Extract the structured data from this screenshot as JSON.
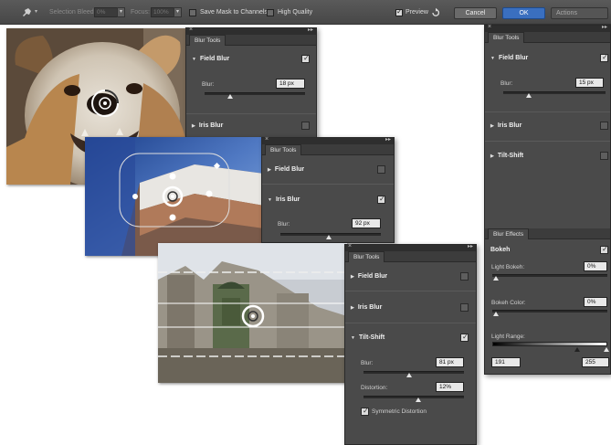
{
  "options_bar": {
    "selection_bleed_label": "Selection Bleed:",
    "selection_bleed_value": "0%",
    "focus_label": "Focus:",
    "focus_value": "100%",
    "save_mask_label": "Save Mask to Channels",
    "save_mask_checked": false,
    "high_quality_label": "High Quality",
    "high_quality_checked": false,
    "preview_label": "Preview",
    "preview_checked": true,
    "cancel_label": "Cancel",
    "ok_label": "OK",
    "actions_label": "Actions"
  },
  "panel_dog": {
    "tab": "Blur Tools",
    "field_blur": {
      "label": "Field Blur",
      "checked": true,
      "blur_label": "Blur:",
      "blur_value": "18 px",
      "slider": 0.4
    },
    "iris_blur": {
      "label": "Iris Blur",
      "checked": false
    }
  },
  "panel_iris": {
    "tab": "Blur Tools",
    "field_blur": {
      "label": "Field Blur",
      "checked": false
    },
    "iris_blur": {
      "label": "Iris Blur",
      "checked": true,
      "blur_label": "Blur:",
      "blur_value": "92 px",
      "slider": 0.48
    }
  },
  "panel_tilt": {
    "tab": "Blur Tools",
    "field_blur": {
      "label": "Field Blur",
      "checked": false
    },
    "iris_blur": {
      "label": "Iris Blur",
      "checked": false
    },
    "tilt_shift": {
      "label": "Tilt-Shift",
      "checked": true,
      "blur_label": "Blur:",
      "blur_value": "81 px",
      "blur_slider": 0.45,
      "distortion_label": "Distortion:",
      "distortion_value": "12%",
      "distortion_slider": 0.55,
      "symmetric_label": "Symmetric Distortion",
      "symmetric_checked": true
    }
  },
  "panel_right": {
    "tab": "Blur Tools",
    "field_blur": {
      "label": "Field Blur",
      "checked": true,
      "blur_label": "Blur:",
      "blur_value": "15 px",
      "slider": 0.35
    },
    "iris_blur": {
      "label": "Iris Blur",
      "checked": false
    },
    "tilt_shift": {
      "label": "Tilt-Shift",
      "checked": false
    },
    "effects_tab": "Blur Effects",
    "bokeh": {
      "label": "Bokeh",
      "checked": true,
      "light_bokeh_label": "Light Bokeh:",
      "light_bokeh_value": "0%",
      "light_bokeh_slider": 0.0,
      "bokeh_color_label": "Bokeh Color:",
      "bokeh_color_value": "0%",
      "bokeh_color_slider": 0.0,
      "light_range_label": "Light Range:",
      "light_range_low": "191",
      "light_range_high": "255"
    }
  },
  "colors": {
    "panel_bg": "#4a4a4a",
    "ok_button": "#3a6fbf",
    "field_bg": "#e8e8e8"
  }
}
